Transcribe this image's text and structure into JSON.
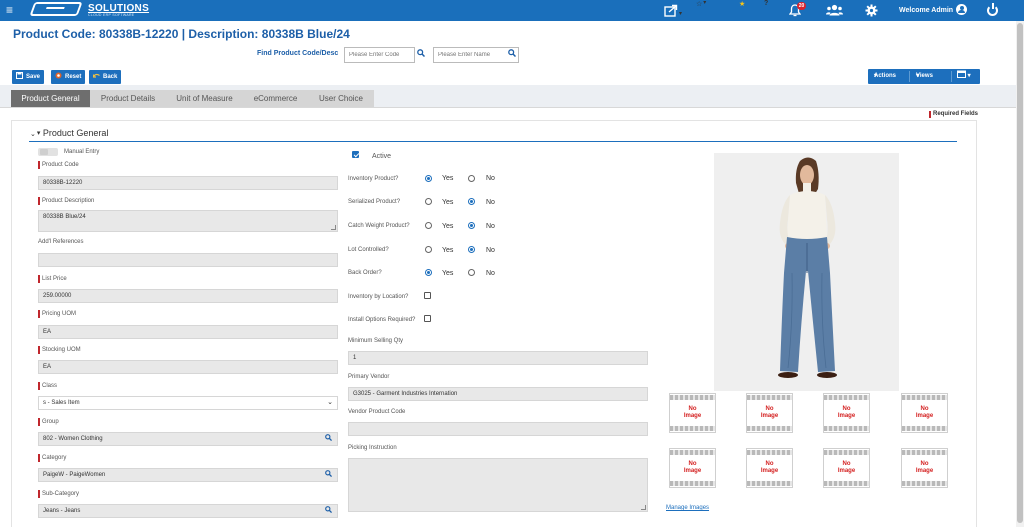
{
  "topbar": {
    "logo_text": "SOLUTIONS",
    "logo_sub": "CLOUD ERP SOFTWARE",
    "notification_count": "20",
    "welcome": "Welcome Admin"
  },
  "header": {
    "title": "Product Code:  80338B-12220 | Description: 80338B Blue/24",
    "find_label": "Find Product Code/Desc",
    "code_placeholder": "Please Enter Code",
    "name_placeholder": "Please Enter Name"
  },
  "toolbar": {
    "save": "Save",
    "reset": "Reset",
    "back": "Back",
    "actions": "Actions",
    "views": "Views"
  },
  "tabs": [
    "Product General",
    "Product Details",
    "Unit of Measure",
    "eCommerce",
    "User Choice"
  ],
  "required_fields": "Required Fields",
  "section_title": "Product General",
  "left": {
    "manual_entry": "Manual Entry",
    "product_code_label": "Product Code",
    "product_code": "80338B-12220",
    "product_desc_label": "Product Description",
    "product_desc": "80338B Blue/24",
    "addl_ref_label": "Add'l References",
    "addl_ref": "",
    "list_price_label": "List Price",
    "list_price": "259.00000",
    "pricing_uom_label": "Pricing UOM",
    "pricing_uom": "EA",
    "stocking_uom_label": "Stocking UOM",
    "stocking_uom": "EA",
    "class_label": "Class",
    "class": "s - Sales Item",
    "group_label": "Group",
    "group": "802 - Women Clothing",
    "category_label": "Category",
    "category": "PaigeW - PaigeWomen",
    "subcategory_label": "Sub-Category",
    "subcategory": "Jeans - Jeans"
  },
  "middle": {
    "active_label": "Active",
    "yes": "Yes",
    "no": "No",
    "inventory_product": "Inventory Product?",
    "serialized_product": "Serialized Product?",
    "catch_weight": "Catch Weight Product?",
    "lot_controlled": "Lot Controlled?",
    "back_order": "Back Order?",
    "inventory_by_location": "Inventory by Location?",
    "install_options": "Install Options Required?",
    "min_selling_label": "Minimum Selling Qty",
    "min_selling": "1",
    "primary_vendor_label": "Primary Vendor",
    "primary_vendor": "G3025 - Garment Industries Internation",
    "vendor_code_label": "Vendor Product Code",
    "vendor_code": "",
    "picking_label": "Picking Instruction",
    "picking": ""
  },
  "images": {
    "no_image": [
      "No",
      "Image"
    ],
    "manage": "Manage Images"
  }
}
